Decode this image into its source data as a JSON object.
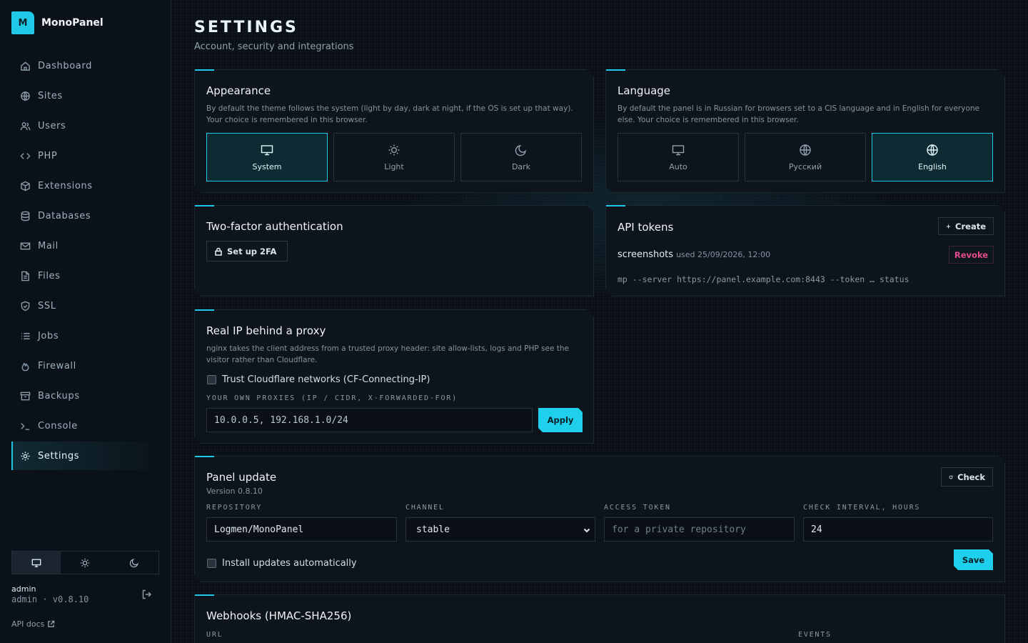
{
  "app": {
    "name": "MonoPanel",
    "logo_letter": "M",
    "accent": "#1fc8e6"
  },
  "sidebar": {
    "items": [
      {
        "label": "Dashboard",
        "icon": "home-icon"
      },
      {
        "label": "Sites",
        "icon": "globe-icon"
      },
      {
        "label": "Users",
        "icon": "users-icon"
      },
      {
        "label": "PHP",
        "icon": "code-icon"
      },
      {
        "label": "Extensions",
        "icon": "box-icon"
      },
      {
        "label": "Databases",
        "icon": "database-icon"
      },
      {
        "label": "Mail",
        "icon": "mail-icon"
      },
      {
        "label": "Files",
        "icon": "file-icon"
      },
      {
        "label": "SSL",
        "icon": "shield-icon"
      },
      {
        "label": "Jobs",
        "icon": "list-icon"
      },
      {
        "label": "Firewall",
        "icon": "flame-icon"
      },
      {
        "label": "Backups",
        "icon": "archive-icon"
      },
      {
        "label": "Console",
        "icon": "terminal-icon"
      },
      {
        "label": "Settings",
        "icon": "gear-icon",
        "active": true
      }
    ],
    "theme_switch": {
      "selected": "system",
      "options": [
        "monitor-icon",
        "sun-icon",
        "moon-icon"
      ]
    },
    "user": {
      "name": "admin",
      "meta": "admin · v0.8.10"
    },
    "api_docs": "API docs"
  },
  "header": {
    "title": "SETTINGS",
    "subtitle": "Account, security and integrations"
  },
  "appearance": {
    "title": "Appearance",
    "desc": "By default the theme follows the system (light by day, dark at night, if the OS is set up that way). Your choice is remembered in this browser.",
    "options": [
      {
        "label": "System",
        "icon": "monitor-icon",
        "selected": true
      },
      {
        "label": "Light",
        "icon": "sun-icon",
        "selected": false
      },
      {
        "label": "Dark",
        "icon": "moon-icon",
        "selected": false
      }
    ]
  },
  "language": {
    "title": "Language",
    "desc": "By default the panel is in Russian for browsers set to a CIS language and in English for everyone else. Your choice is remembered in this browser.",
    "options": [
      {
        "label": "Auto",
        "icon": "monitor-icon",
        "selected": false
      },
      {
        "label": "Русский",
        "icon": "globe-icon",
        "selected": false
      },
      {
        "label": "English",
        "icon": "globe-icon",
        "selected": true
      }
    ]
  },
  "twofa": {
    "title": "Two-factor authentication",
    "button": "Set up 2FA"
  },
  "api_tokens": {
    "title": "API tokens",
    "create": "Create",
    "token_name": "screenshots",
    "token_used": "used 25/09/2026, 12:00",
    "revoke": "Revoke",
    "command": "mp --server https://panel.example.com:8443 --token … status"
  },
  "real_ip": {
    "title": "Real IP behind a proxy",
    "desc": "nginx takes the client address from a trusted proxy header: site allow-lists, logs and PHP see the visitor rather than Cloudflare.",
    "checkbox": "Trust Cloudflare networks (CF-Connecting-IP)",
    "proxies_label": "YOUR OWN PROXIES (IP / CIDR, X-FORWARDED-FOR)",
    "proxies_value": "10.0.0.5, 192.168.1.0/24",
    "apply": "Apply"
  },
  "panel_update": {
    "title": "Panel update",
    "version": "Version 0.8.10",
    "check": "Check",
    "repository_label": "REPOSITORY",
    "repository_value": "Logmen/MonoPanel",
    "channel_label": "CHANNEL",
    "channel_value": "stable",
    "token_label": "ACCESS TOKEN",
    "token_placeholder": "for a private repository",
    "interval_label": "CHECK INTERVAL, HOURS",
    "interval_value": "24",
    "auto_checkbox": "Install updates automatically",
    "save": "Save"
  },
  "webhooks": {
    "title": "Webhooks (HMAC-SHA256)",
    "url_label": "URL",
    "events_label": "EVENTS"
  }
}
